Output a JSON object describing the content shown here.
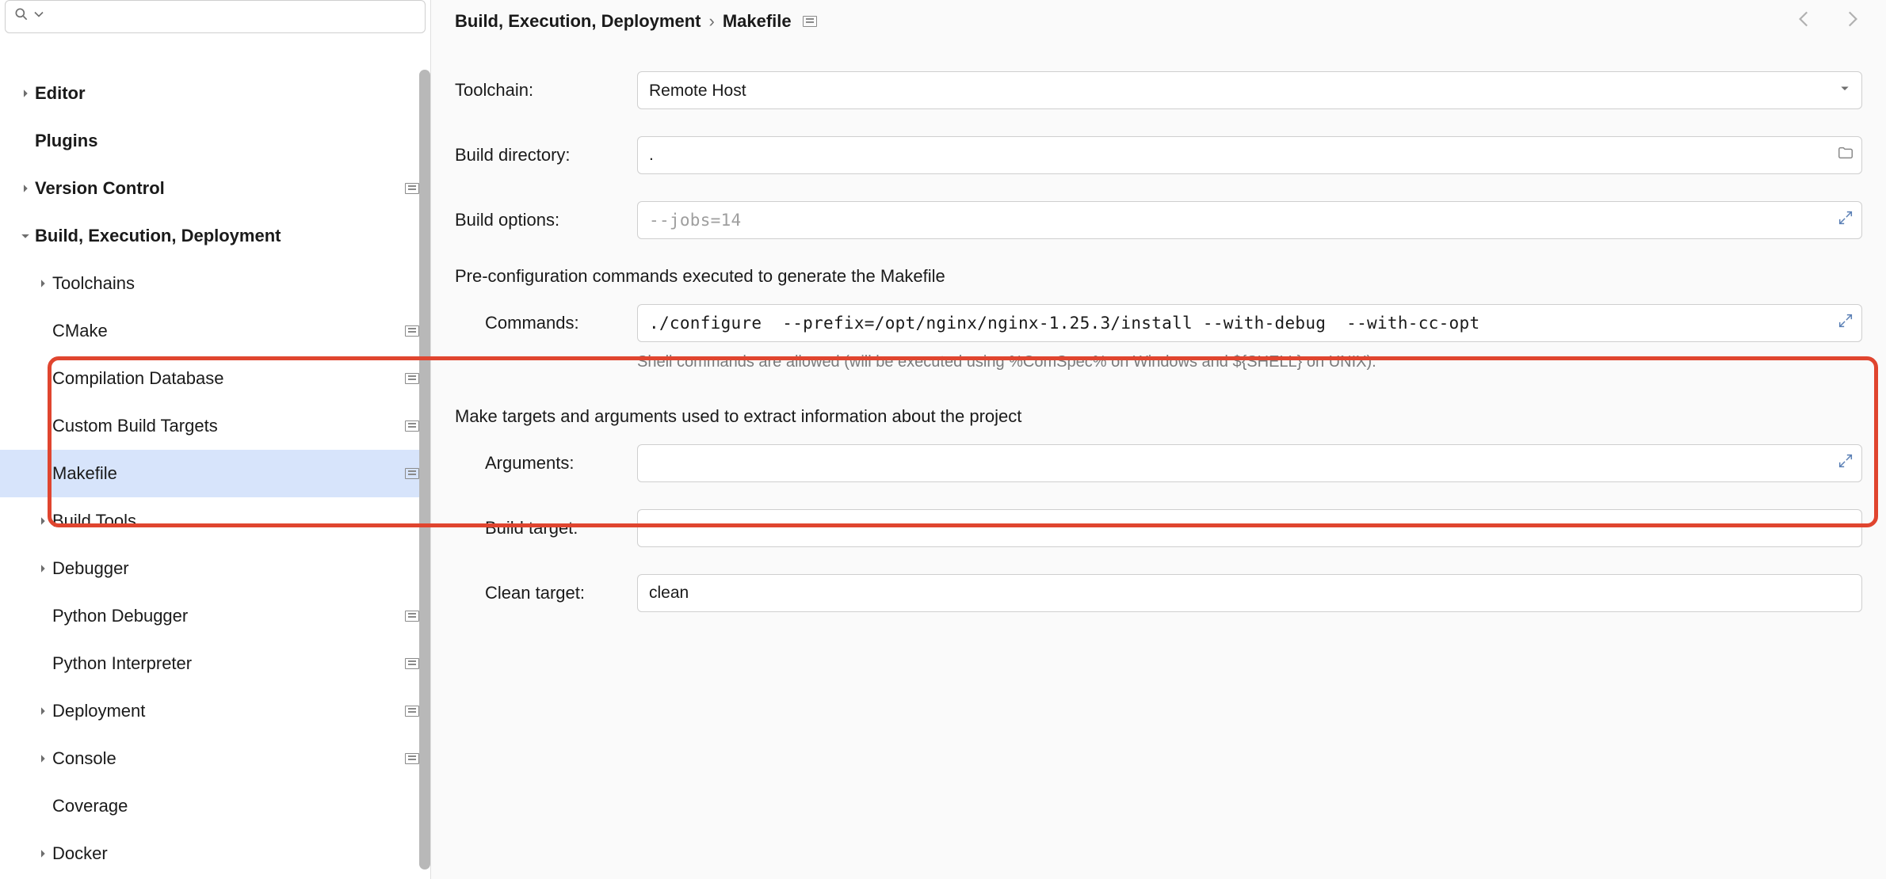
{
  "breadcrumb": {
    "parent": "Build, Execution, Deployment",
    "current": "Makefile"
  },
  "sidebar": {
    "search_placeholder": "",
    "items": [
      {
        "label": "Editor",
        "level": 0,
        "expandable": true,
        "expanded": false,
        "modified": false
      },
      {
        "label": "Plugins",
        "level": 0,
        "expandable": false,
        "expanded": false,
        "modified": false
      },
      {
        "label": "Version Control",
        "level": 0,
        "expandable": true,
        "expanded": false,
        "modified": true
      },
      {
        "label": "Build, Execution, Deployment",
        "level": 0,
        "expandable": true,
        "expanded": true,
        "modified": false
      },
      {
        "label": "Toolchains",
        "level": 1,
        "expandable": true,
        "expanded": false,
        "modified": false
      },
      {
        "label": "CMake",
        "level": 1,
        "expandable": false,
        "expanded": false,
        "modified": true
      },
      {
        "label": "Compilation Database",
        "level": 1,
        "expandable": false,
        "expanded": false,
        "modified": true
      },
      {
        "label": "Custom Build Targets",
        "level": 1,
        "expandable": false,
        "expanded": false,
        "modified": true
      },
      {
        "label": "Makefile",
        "level": 1,
        "expandable": false,
        "expanded": false,
        "modified": true,
        "selected": true
      },
      {
        "label": "Build Tools",
        "level": 1,
        "expandable": true,
        "expanded": false,
        "modified": false
      },
      {
        "label": "Debugger",
        "level": 1,
        "expandable": true,
        "expanded": false,
        "modified": false
      },
      {
        "label": "Python Debugger",
        "level": 1,
        "expandable": false,
        "expanded": false,
        "modified": true
      },
      {
        "label": "Python Interpreter",
        "level": 1,
        "expandable": false,
        "expanded": false,
        "modified": true
      },
      {
        "label": "Deployment",
        "level": 1,
        "expandable": true,
        "expanded": false,
        "modified": true
      },
      {
        "label": "Console",
        "level": 1,
        "expandable": true,
        "expanded": false,
        "modified": true
      },
      {
        "label": "Coverage",
        "level": 1,
        "expandable": false,
        "expanded": false,
        "modified": false
      },
      {
        "label": "Docker",
        "level": 1,
        "expandable": true,
        "expanded": false,
        "modified": false
      }
    ]
  },
  "form": {
    "toolchain": {
      "label": "Toolchain:",
      "value": "Remote Host"
    },
    "build_dir": {
      "label": "Build directory:",
      "value": "."
    },
    "build_opts": {
      "label": "Build options:",
      "placeholder": "--jobs=14",
      "value": ""
    },
    "preconf_section": "Pre-configuration commands executed to generate the Makefile",
    "commands": {
      "label": "Commands:",
      "value": "./configure  --prefix=/opt/nginx/nginx-1.25.3/install --with-debug  --with-cc-opt"
    },
    "commands_hint": "Shell commands are allowed (will be executed using %ComSpec% on Windows and ${SHELL} on UNIX).",
    "make_section": "Make targets and arguments used to extract information about the project",
    "arguments": {
      "label": "Arguments:",
      "value": ""
    },
    "build_target": {
      "label": "Build target:",
      "value": ""
    },
    "clean_target": {
      "label": "Clean target:",
      "value": "clean"
    }
  }
}
